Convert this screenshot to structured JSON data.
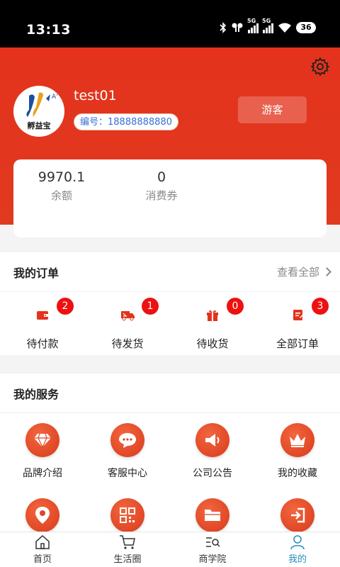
{
  "status_bar": {
    "time": "13:13",
    "network_1": "5G",
    "network_2": "5G",
    "battery": "36"
  },
  "profile": {
    "username": "test01",
    "member_id": "编号：18888888880",
    "guest_button": "游客",
    "avatar_text": "孵益宝"
  },
  "wallet": {
    "balance_value": "9970.1",
    "balance_label": "余额",
    "coupon_value": "0",
    "coupon_label": "消费券"
  },
  "orders": {
    "title": "我的订单",
    "view_all": "查看全部",
    "items": [
      {
        "label": "待付款",
        "badge": "2",
        "icon": "wallet-icon"
      },
      {
        "label": "待发货",
        "badge": "1",
        "icon": "delivery-truck-icon"
      },
      {
        "label": "待收货",
        "badge": "0",
        "icon": "gift-box-icon"
      },
      {
        "label": "全部订单",
        "badge": "3",
        "icon": "order-list-icon"
      }
    ]
  },
  "services": {
    "title": "我的服务",
    "items": [
      {
        "label": "品牌介绍",
        "icon": "diamond-icon"
      },
      {
        "label": "客服中心",
        "icon": "chat-bubble-icon"
      },
      {
        "label": "公司公告",
        "icon": "megaphone-icon"
      },
      {
        "label": "我的收藏",
        "icon": "crown-icon"
      },
      {
        "label": "",
        "icon": "location-pin-icon"
      },
      {
        "label": "",
        "icon": "qr-code-icon"
      },
      {
        "label": "",
        "icon": "folder-icon"
      },
      {
        "label": "",
        "icon": "logout-icon"
      }
    ]
  },
  "tabbar": {
    "items": [
      {
        "label": "首页",
        "icon": "home-icon",
        "active": false
      },
      {
        "label": "生活圈",
        "icon": "cart-icon",
        "active": false
      },
      {
        "label": "商学院",
        "icon": "search-list-icon",
        "active": false
      },
      {
        "label": "我的",
        "icon": "user-icon",
        "active": true
      }
    ]
  },
  "colors": {
    "brand": "#e4321c",
    "badge": "#ee1111",
    "active_tab": "#2a8fbf",
    "id_text": "#3a6fd8"
  }
}
